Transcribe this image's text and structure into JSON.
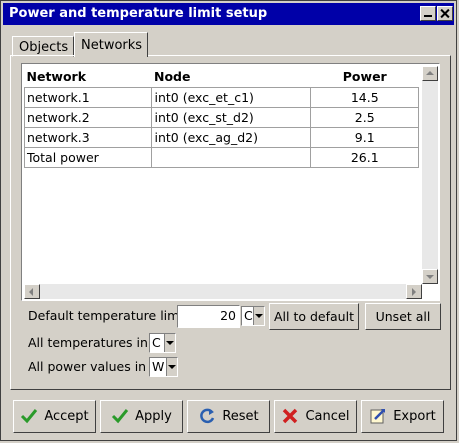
{
  "window": {
    "title": "Power and temperature limit setup"
  },
  "tabs": [
    {
      "label": "Objects"
    },
    {
      "label": "Networks"
    }
  ],
  "table": {
    "headers": {
      "network": "Network",
      "node": "Node",
      "power": "Power"
    },
    "rows": [
      {
        "network": "network.1",
        "node": "int0 (exc_et_c1)",
        "power": "14.5"
      },
      {
        "network": "network.2",
        "node": "int0 (exc_st_d2)",
        "power": "2.5"
      },
      {
        "network": "network.3",
        "node": "int0 (exc_ag_d2)",
        "power": "9.1"
      }
    ],
    "total": {
      "label": "Total power",
      "node": "",
      "power": "26.1"
    }
  },
  "settings": {
    "default_temp_label": "Default temperature limit",
    "default_temp_value": "20",
    "default_temp_unit": "C",
    "all_to_default": "All to default",
    "unset_all": "Unset all",
    "all_temps_label": "All temperatures in",
    "all_temps_unit": "C",
    "all_power_label": "All power values in",
    "all_power_unit": "W"
  },
  "buttons": {
    "accept": "Accept",
    "apply": "Apply",
    "reset": "Reset",
    "cancel": "Cancel",
    "export": "Export"
  }
}
